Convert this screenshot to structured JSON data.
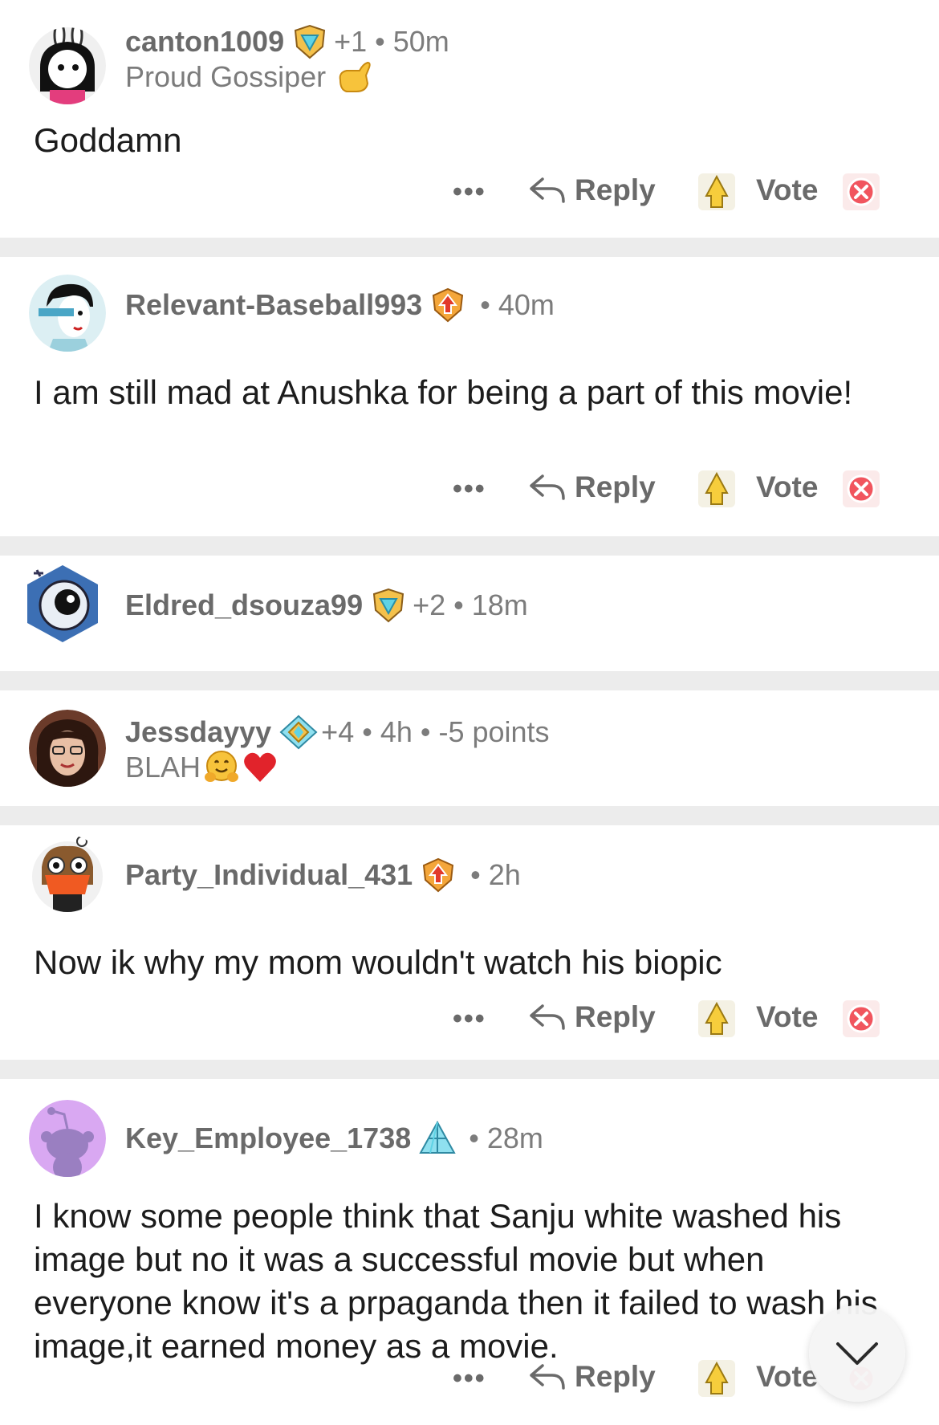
{
  "colors": {
    "background": "#ffffff",
    "divider": "#ececec",
    "meta_text": "#7c7c7c",
    "body_text": "#1c1c1c"
  },
  "actions": {
    "more": "•••",
    "reply": "Reply",
    "vote": "Vote"
  },
  "comments": [
    {
      "username": "canton1009",
      "badge_icon": "shield-gem-badge-icon",
      "extra": "+1",
      "time": "50m",
      "flair": "Proud Gossiper",
      "flair_emojis": [
        "call-me-hand-icon"
      ],
      "text": "Goddamn"
    },
    {
      "username": "Relevant-Baseball993",
      "badge_icon": "upvote-shield-badge-icon",
      "time": "40m",
      "text": "I am still mad at Anushka for being a part of this movie!"
    },
    {
      "username": "Eldred_dsouza99",
      "badge_icon": "shield-gem-badge-icon",
      "extra": "+2",
      "time": "18m"
    },
    {
      "username": "Jessdayyy",
      "badge_icon": "diamond-badge-icon",
      "extra": "+4",
      "time": "4h",
      "points": "-5 points",
      "flair": "BLAH",
      "flair_emojis": [
        "hugging-face-icon",
        "red-heart-icon"
      ]
    },
    {
      "username": "Party_Individual_431",
      "badge_icon": "upvote-shield-badge-icon",
      "time": "2h",
      "text": "Now ik why my mom wouldn't watch his biopic"
    },
    {
      "username": "Key_Employee_1738",
      "badge_icon": "crystal-badge-icon",
      "time": "28m",
      "text": "I know some people think that Sanju white washed his image but no it was a successful movie but when everyone know it's a prpaganda then it failed to wash his image,it earned money as a movie."
    }
  ]
}
